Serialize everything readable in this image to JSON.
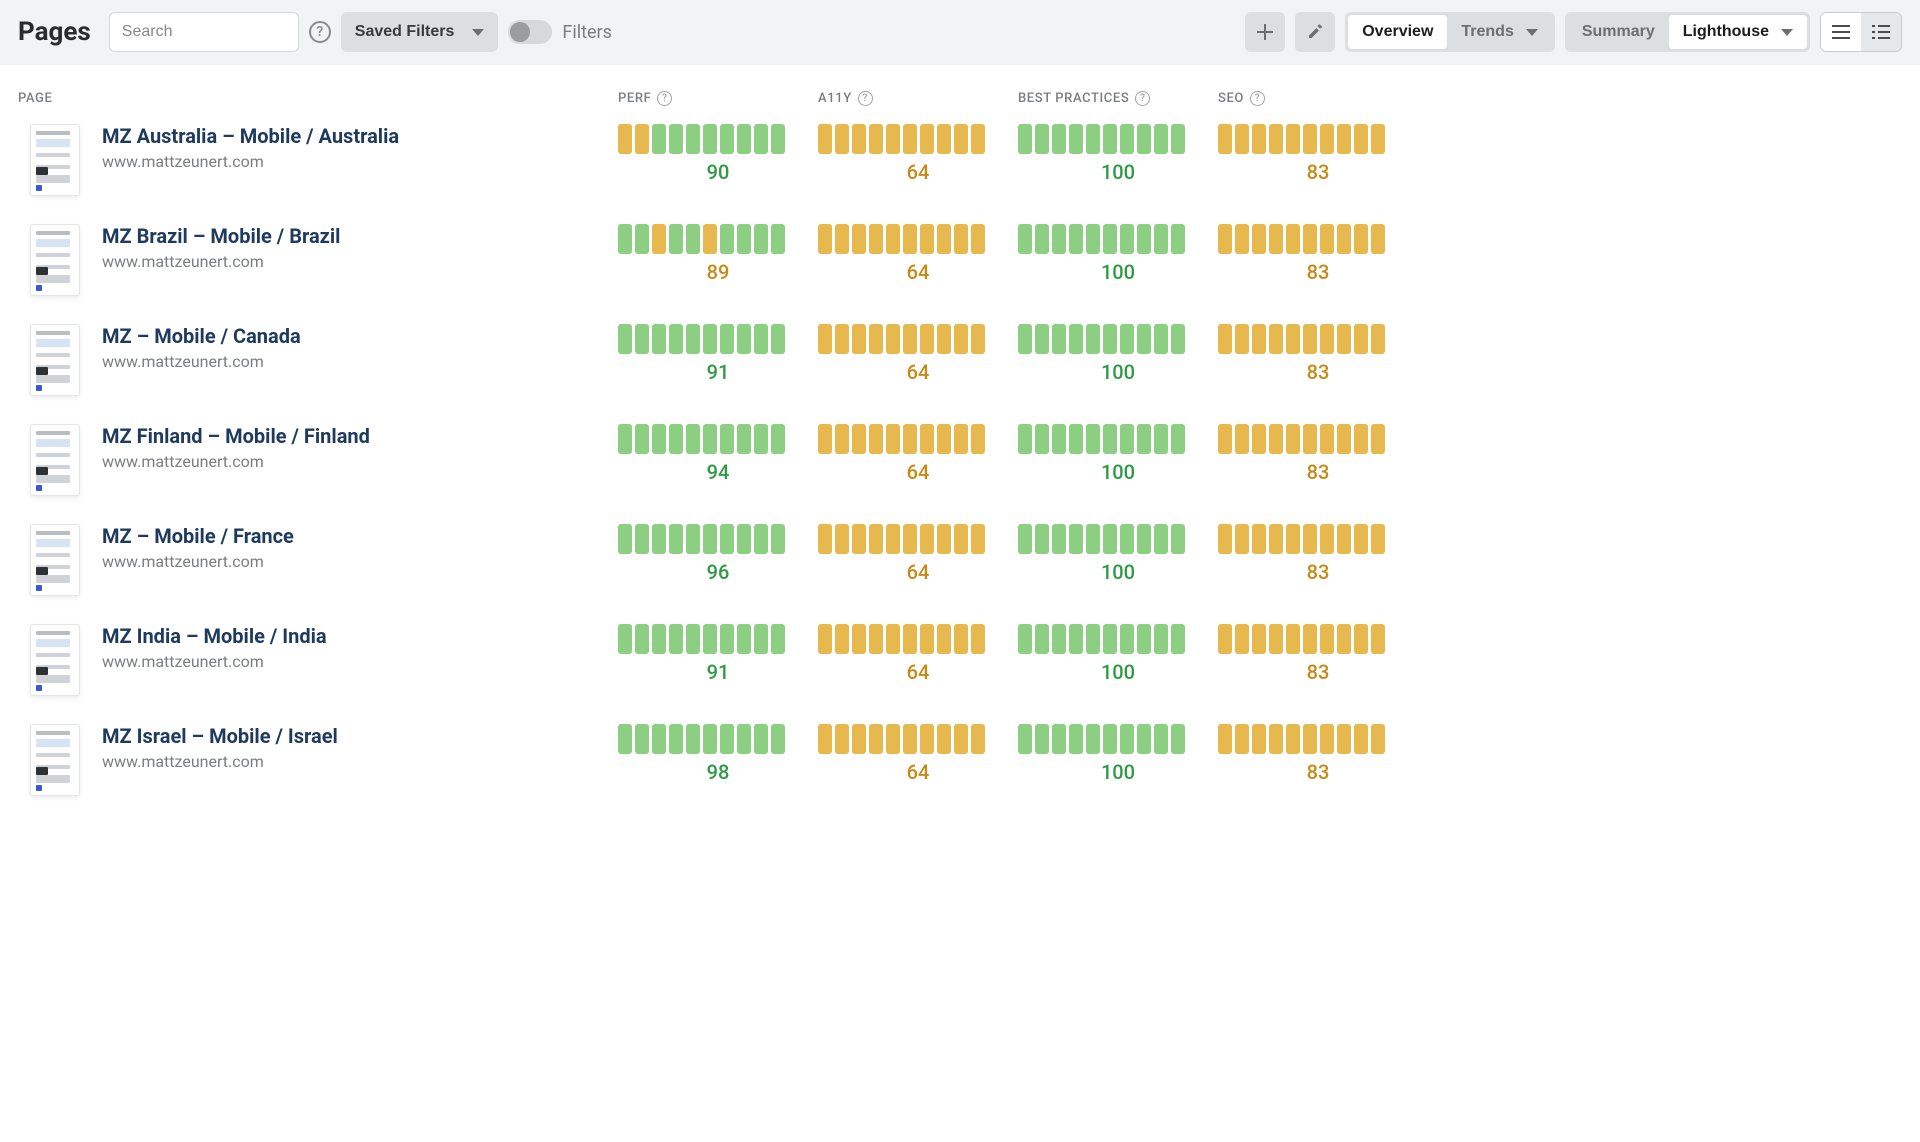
{
  "header": {
    "title": "Pages",
    "search_placeholder": "Search",
    "saved_filters_label": "Saved Filters",
    "filters_label": "Filters",
    "tabs_view": {
      "overview": "Overview",
      "trends": "Trends"
    },
    "tabs_mode": {
      "summary": "Summary",
      "lighthouse": "Lighthouse"
    }
  },
  "columns": {
    "page": "PAGE",
    "perf": "PERF",
    "a11y": "A11Y",
    "bp": "BEST PRACTICES",
    "seo": "SEO"
  },
  "colors": {
    "green": "#8ccf82",
    "orange": "#e7b84e",
    "score_green": "#2e9a44",
    "score_orange": "#c78a17"
  },
  "rows": [
    {
      "title": "MZ Australia – Mobile / Australia",
      "url": "www.mattzeunert.com",
      "metrics": {
        "perf": {
          "score": 90,
          "bars": [
            "orange",
            "orange",
            "green",
            "green",
            "green",
            "green",
            "green",
            "green",
            "green",
            "green"
          ]
        },
        "a11y": {
          "score": 64,
          "bars": [
            "orange",
            "orange",
            "orange",
            "orange",
            "orange",
            "orange",
            "orange",
            "orange",
            "orange",
            "orange"
          ]
        },
        "bp": {
          "score": 100,
          "bars": [
            "green",
            "green",
            "green",
            "green",
            "green",
            "green",
            "green",
            "green",
            "green",
            "green"
          ]
        },
        "seo": {
          "score": 83,
          "bars": [
            "orange",
            "orange",
            "orange",
            "orange",
            "orange",
            "orange",
            "orange",
            "orange",
            "orange",
            "orange"
          ]
        }
      }
    },
    {
      "title": "MZ Brazil – Mobile / Brazil",
      "url": "www.mattzeunert.com",
      "metrics": {
        "perf": {
          "score": 89,
          "bars": [
            "green",
            "green",
            "orange",
            "green",
            "green",
            "orange",
            "green",
            "green",
            "green",
            "green"
          ]
        },
        "a11y": {
          "score": 64,
          "bars": [
            "orange",
            "orange",
            "orange",
            "orange",
            "orange",
            "orange",
            "orange",
            "orange",
            "orange",
            "orange"
          ]
        },
        "bp": {
          "score": 100,
          "bars": [
            "green",
            "green",
            "green",
            "green",
            "green",
            "green",
            "green",
            "green",
            "green",
            "green"
          ]
        },
        "seo": {
          "score": 83,
          "bars": [
            "orange",
            "orange",
            "orange",
            "orange",
            "orange",
            "orange",
            "orange",
            "orange",
            "orange",
            "orange"
          ]
        }
      }
    },
    {
      "title": "MZ – Mobile / Canada",
      "url": "www.mattzeunert.com",
      "metrics": {
        "perf": {
          "score": 91,
          "bars": [
            "green",
            "green",
            "green",
            "green",
            "green",
            "green",
            "green",
            "green",
            "green",
            "green"
          ]
        },
        "a11y": {
          "score": 64,
          "bars": [
            "orange",
            "orange",
            "orange",
            "orange",
            "orange",
            "orange",
            "orange",
            "orange",
            "orange",
            "orange"
          ]
        },
        "bp": {
          "score": 100,
          "bars": [
            "green",
            "green",
            "green",
            "green",
            "green",
            "green",
            "green",
            "green",
            "green",
            "green"
          ]
        },
        "seo": {
          "score": 83,
          "bars": [
            "orange",
            "orange",
            "orange",
            "orange",
            "orange",
            "orange",
            "orange",
            "orange",
            "orange",
            "orange"
          ]
        }
      }
    },
    {
      "title": "MZ Finland – Mobile / Finland",
      "url": "www.mattzeunert.com",
      "metrics": {
        "perf": {
          "score": 94,
          "bars": [
            "green",
            "green",
            "green",
            "green",
            "green",
            "green",
            "green",
            "green",
            "green",
            "green"
          ]
        },
        "a11y": {
          "score": 64,
          "bars": [
            "orange",
            "orange",
            "orange",
            "orange",
            "orange",
            "orange",
            "orange",
            "orange",
            "orange",
            "orange"
          ]
        },
        "bp": {
          "score": 100,
          "bars": [
            "green",
            "green",
            "green",
            "green",
            "green",
            "green",
            "green",
            "green",
            "green",
            "green"
          ]
        },
        "seo": {
          "score": 83,
          "bars": [
            "orange",
            "orange",
            "orange",
            "orange",
            "orange",
            "orange",
            "orange",
            "orange",
            "orange",
            "orange"
          ]
        }
      }
    },
    {
      "title": "MZ – Mobile / France",
      "url": "www.mattzeunert.com",
      "metrics": {
        "perf": {
          "score": 96,
          "bars": [
            "green",
            "green",
            "green",
            "green",
            "green",
            "green",
            "green",
            "green",
            "green",
            "green"
          ]
        },
        "a11y": {
          "score": 64,
          "bars": [
            "orange",
            "orange",
            "orange",
            "orange",
            "orange",
            "orange",
            "orange",
            "orange",
            "orange",
            "orange"
          ]
        },
        "bp": {
          "score": 100,
          "bars": [
            "green",
            "green",
            "green",
            "green",
            "green",
            "green",
            "green",
            "green",
            "green",
            "green"
          ]
        },
        "seo": {
          "score": 83,
          "bars": [
            "orange",
            "orange",
            "orange",
            "orange",
            "orange",
            "orange",
            "orange",
            "orange",
            "orange",
            "orange"
          ]
        }
      }
    },
    {
      "title": "MZ India – Mobile / India",
      "url": "www.mattzeunert.com",
      "metrics": {
        "perf": {
          "score": 91,
          "bars": [
            "green",
            "green",
            "green",
            "green",
            "green",
            "green",
            "green",
            "green",
            "green",
            "green"
          ]
        },
        "a11y": {
          "score": 64,
          "bars": [
            "orange",
            "orange",
            "orange",
            "orange",
            "orange",
            "orange",
            "orange",
            "orange",
            "orange",
            "orange"
          ]
        },
        "bp": {
          "score": 100,
          "bars": [
            "green",
            "green",
            "green",
            "green",
            "green",
            "green",
            "green",
            "green",
            "green",
            "green"
          ]
        },
        "seo": {
          "score": 83,
          "bars": [
            "orange",
            "orange",
            "orange",
            "orange",
            "orange",
            "orange",
            "orange",
            "orange",
            "orange",
            "orange"
          ]
        }
      }
    },
    {
      "title": "MZ Israel – Mobile / Israel",
      "url": "www.mattzeunert.com",
      "metrics": {
        "perf": {
          "score": 98,
          "bars": [
            "green",
            "green",
            "green",
            "green",
            "green",
            "green",
            "green",
            "green",
            "green",
            "green"
          ]
        },
        "a11y": {
          "score": 64,
          "bars": [
            "orange",
            "orange",
            "orange",
            "orange",
            "orange",
            "orange",
            "orange",
            "orange",
            "orange",
            "orange"
          ]
        },
        "bp": {
          "score": 100,
          "bars": [
            "green",
            "green",
            "green",
            "green",
            "green",
            "green",
            "green",
            "green",
            "green",
            "green"
          ]
        },
        "seo": {
          "score": 83,
          "bars": [
            "orange",
            "orange",
            "orange",
            "orange",
            "orange",
            "orange",
            "orange",
            "orange",
            "orange",
            "orange"
          ]
        }
      }
    }
  ]
}
